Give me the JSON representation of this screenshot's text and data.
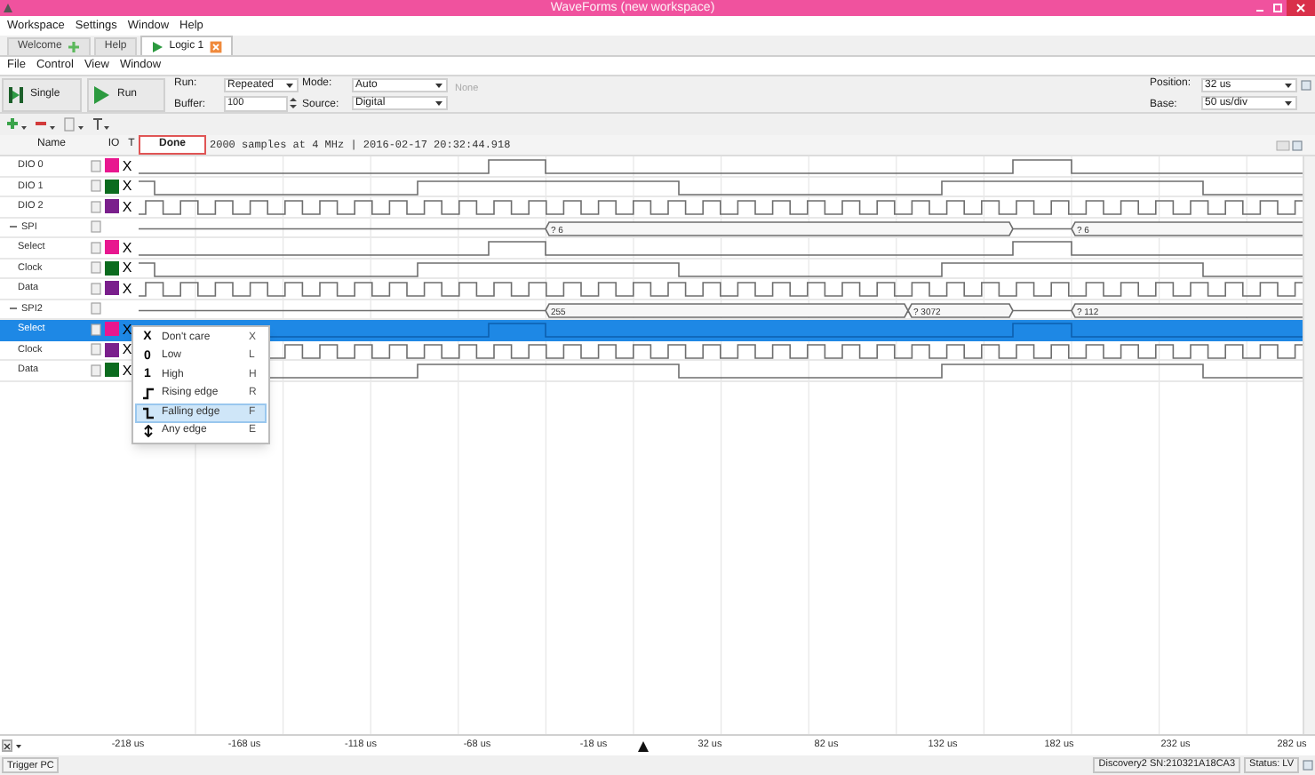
{
  "window": {
    "title": "WaveForms (new workspace)"
  },
  "menu": [
    "Workspace",
    "Settings",
    "Window",
    "Help"
  ],
  "tabs": [
    {
      "label": "Welcome",
      "kind": "start",
      "selected": false
    },
    {
      "label": "Help",
      "kind": "plain",
      "selected": false
    },
    {
      "label": "Logic 1",
      "kind": "instrument",
      "selected": true
    }
  ],
  "instrument_menu": [
    "File",
    "Control",
    "View",
    "Window"
  ],
  "toolbar": {
    "single": "Single",
    "run": "Run",
    "run_label": "Run:",
    "run_value": "Repeated",
    "buffer_label": "Buffer:",
    "buffer_value": "100",
    "mode_label": "Mode:",
    "mode_value": "Auto",
    "source_label": "Source:",
    "source_value": "Digital",
    "trigger_source": "None",
    "position_label": "Position:",
    "position_value": "32 us",
    "base_label": "Base:",
    "base_value": "50 us/div"
  },
  "columns": [
    "Name",
    "IO",
    "T"
  ],
  "acquisition": {
    "status": "Done",
    "info": "2000 samples at 4 MHz | 2016-02-17 20:32:44.918"
  },
  "channels": [
    {
      "name": "DIO 0",
      "kind": "signal",
      "color": "#e8178f",
      "trigger": "X",
      "selected": false
    },
    {
      "name": "DIO 1",
      "kind": "signal",
      "color": "#0b6b1e",
      "trigger": "X",
      "selected": false
    },
    {
      "name": "DIO 2",
      "kind": "signal",
      "color": "#7a1f8c",
      "trigger": "X",
      "selected": false
    },
    {
      "name": "SPI",
      "kind": "bus",
      "expanded": true,
      "selected": false,
      "values": [
        "? 6",
        "? 6"
      ],
      "children": [
        {
          "name": "Select",
          "kind": "signal",
          "color": "#e8178f",
          "trigger": "X",
          "selected": false
        },
        {
          "name": "Clock",
          "kind": "signal",
          "color": "#0b6b1e",
          "trigger": "X",
          "selected": false
        },
        {
          "name": "Data",
          "kind": "signal",
          "color": "#7a1f8c",
          "trigger": "X",
          "selected": false
        }
      ]
    },
    {
      "name": "SPI2",
      "kind": "bus",
      "expanded": true,
      "selected": false,
      "values": [
        "255",
        "? 3072",
        "? 112"
      ],
      "children": [
        {
          "name": "Select",
          "kind": "signal",
          "color": "#e8178f",
          "trigger": "X",
          "selected": true
        },
        {
          "name": "Clock",
          "kind": "signal",
          "color": "#7a1f8c",
          "trigger": "X",
          "selected": false
        },
        {
          "name": "Data",
          "kind": "signal",
          "color": "#0b6b1e",
          "trigger": "X",
          "selected": false
        }
      ]
    }
  ],
  "context_menu": [
    {
      "kind": "glyph",
      "glyph": "X",
      "label": "Don't care",
      "shortcut": "X",
      "selected": false
    },
    {
      "kind": "glyph",
      "glyph": "0",
      "label": "Low",
      "shortcut": "L",
      "selected": false
    },
    {
      "kind": "glyph",
      "glyph": "1",
      "label": "High",
      "shortcut": "H",
      "selected": false
    },
    {
      "kind": "rising",
      "label": "Rising edge",
      "shortcut": "R",
      "selected": false
    },
    {
      "kind": "falling",
      "label": "Falling edge",
      "shortcut": "F",
      "selected": true
    },
    {
      "kind": "any",
      "label": "Any edge",
      "shortcut": "E",
      "selected": false
    }
  ],
  "time_axis": [
    "-218 us",
    "-168 us",
    "-118 us",
    "-68 us",
    "-18 us",
    "32 us",
    "82 us",
    "132 us",
    "182 us",
    "232 us",
    "282 us"
  ],
  "status_bar": {
    "trigger": "Trigger PC",
    "device": "Discovery2 SN:210321A18CA3",
    "status": "Status: LV"
  }
}
